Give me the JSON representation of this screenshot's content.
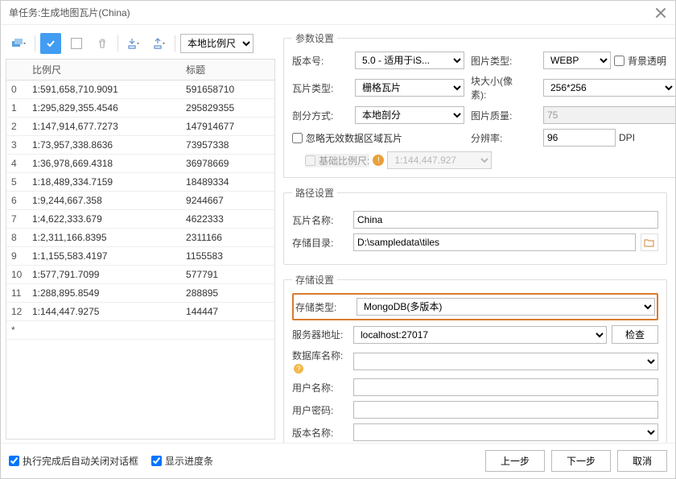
{
  "title": "单任务:生成地图瓦片(China)",
  "toolbar": {
    "scale_select": "本地比例尺"
  },
  "table": {
    "headers": {
      "idx": "",
      "scale": "比例尺",
      "title": "标题"
    },
    "rows": [
      {
        "idx": "0",
        "scale": "1:591,658,710.9091",
        "title": "591658710"
      },
      {
        "idx": "1",
        "scale": "1:295,829,355.4546",
        "title": "295829355"
      },
      {
        "idx": "2",
        "scale": "1:147,914,677.7273",
        "title": "147914677"
      },
      {
        "idx": "3",
        "scale": "1:73,957,338.8636",
        "title": "73957338"
      },
      {
        "idx": "4",
        "scale": "1:36,978,669.4318",
        "title": "36978669"
      },
      {
        "idx": "5",
        "scale": "1:18,489,334.7159",
        "title": "18489334"
      },
      {
        "idx": "6",
        "scale": "1:9,244,667.358",
        "title": "9244667"
      },
      {
        "idx": "7",
        "scale": "1:4,622,333.679",
        "title": "4622333"
      },
      {
        "idx": "8",
        "scale": "1:2,311,166.8395",
        "title": "2311166"
      },
      {
        "idx": "9",
        "scale": "1:1,155,583.4197",
        "title": "1155583"
      },
      {
        "idx": "10",
        "scale": "1:577,791.7099",
        "title": "577791"
      },
      {
        "idx": "11",
        "scale": "1:288,895.8549",
        "title": "288895"
      },
      {
        "idx": "12",
        "scale": "1:144,447.9275",
        "title": "144447"
      },
      {
        "idx": "*",
        "scale": "",
        "title": ""
      }
    ]
  },
  "params": {
    "legend": "参数设置",
    "version_label": "版本号:",
    "version_value": "5.0 - 适用于iS...",
    "imgtype_label": "图片类型:",
    "imgtype_value": "WEBP",
    "transparent_label": "背景透明",
    "tiletype_label": "瓦片类型:",
    "tiletype_value": "栅格瓦片",
    "blocksize_label": "块大小(像素):",
    "blocksize_value": "256*256",
    "split_label": "剖分方式:",
    "split_value": "本地剖分",
    "quality_label": "图片质量:",
    "quality_value": "75",
    "ignore_label": "忽略无效数据区域瓦片",
    "res_label": "分辨率:",
    "res_value": "96",
    "res_unit": "DPI",
    "basescale_label": "基础比例尺:",
    "basescale_value": "1:144,447.927"
  },
  "path": {
    "legend": "路径设置",
    "name_label": "瓦片名称:",
    "name_value": "China",
    "dir_label": "存储目录:",
    "dir_value": "D:\\sampledata\\tiles"
  },
  "storage": {
    "legend": "存储设置",
    "type_label": "存储类型:",
    "type_value": "MongoDB(多版本)",
    "server_label": "服务器地址:",
    "server_value": "localhost:27017",
    "check_btn": "检查",
    "db_label": "数据库名称:",
    "db_value": "",
    "user_label": "用户名称:",
    "user_value": "",
    "pwd_label": "用户密码:",
    "pwd_value": "",
    "ver_label": "版本名称:",
    "ver_value": ""
  },
  "footer": {
    "autoclose": "执行完成后自动关闭对话框",
    "progress": "显示进度条",
    "prev": "上一步",
    "next": "下一步",
    "cancel": "取消"
  }
}
